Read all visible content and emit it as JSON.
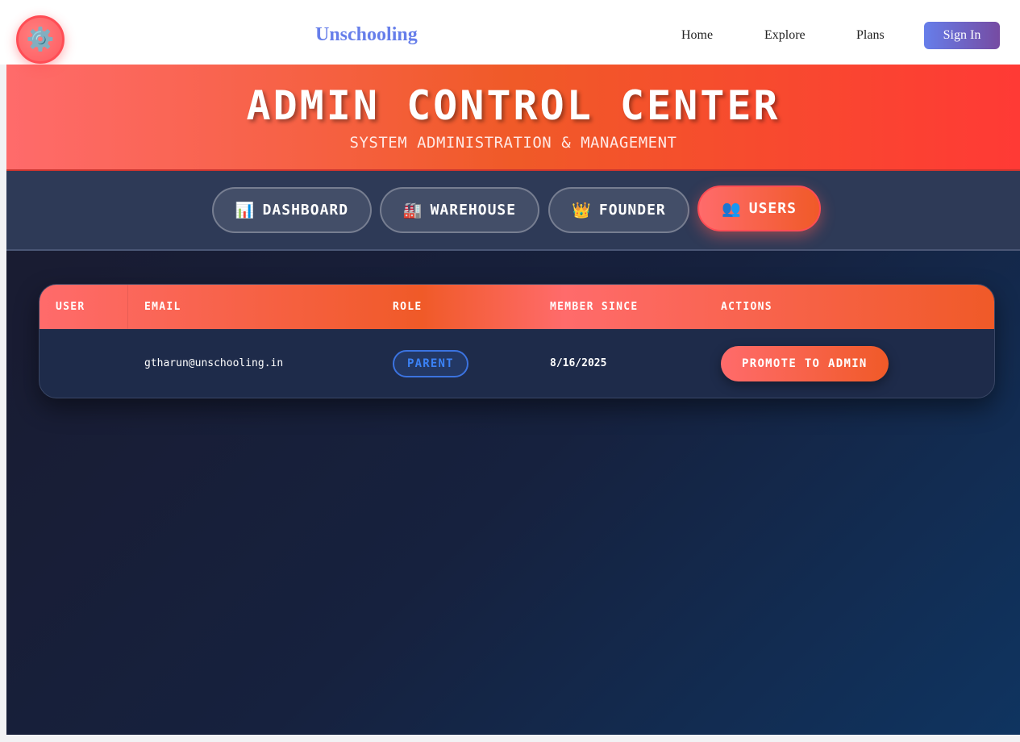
{
  "header": {
    "gear_icon": "⚙️",
    "brand": "Unschooling",
    "nav": [
      "Home",
      "Explore",
      "Plans"
    ],
    "signin_label": "Sign In"
  },
  "hero": {
    "title": "ADMIN CONTROL CENTER",
    "subtitle": "SYSTEM ADMINISTRATION & MANAGEMENT"
  },
  "tabs": [
    {
      "icon": "📊",
      "label": "DASHBOARD",
      "active": false
    },
    {
      "icon": "🏭",
      "label": "WAREHOUSE",
      "active": false
    },
    {
      "icon": "👑",
      "label": "FOUNDER",
      "active": false
    },
    {
      "icon": "👥",
      "label": "USERS",
      "active": true
    }
  ],
  "table": {
    "columns": [
      "USER",
      "EMAIL",
      "ROLE",
      "MEMBER SINCE",
      "ACTIONS"
    ],
    "rows": [
      {
        "user": "",
        "email": "gtharun@unschooling.in",
        "role": "PARENT",
        "member_since": "8/16/2025",
        "action": "PROMOTE TO ADMIN"
      }
    ]
  },
  "colors": {
    "brand": "#667eea",
    "accent": "#ff6b6b",
    "accent_dark": "#f05a28",
    "role_badge": "#3b82f6"
  }
}
